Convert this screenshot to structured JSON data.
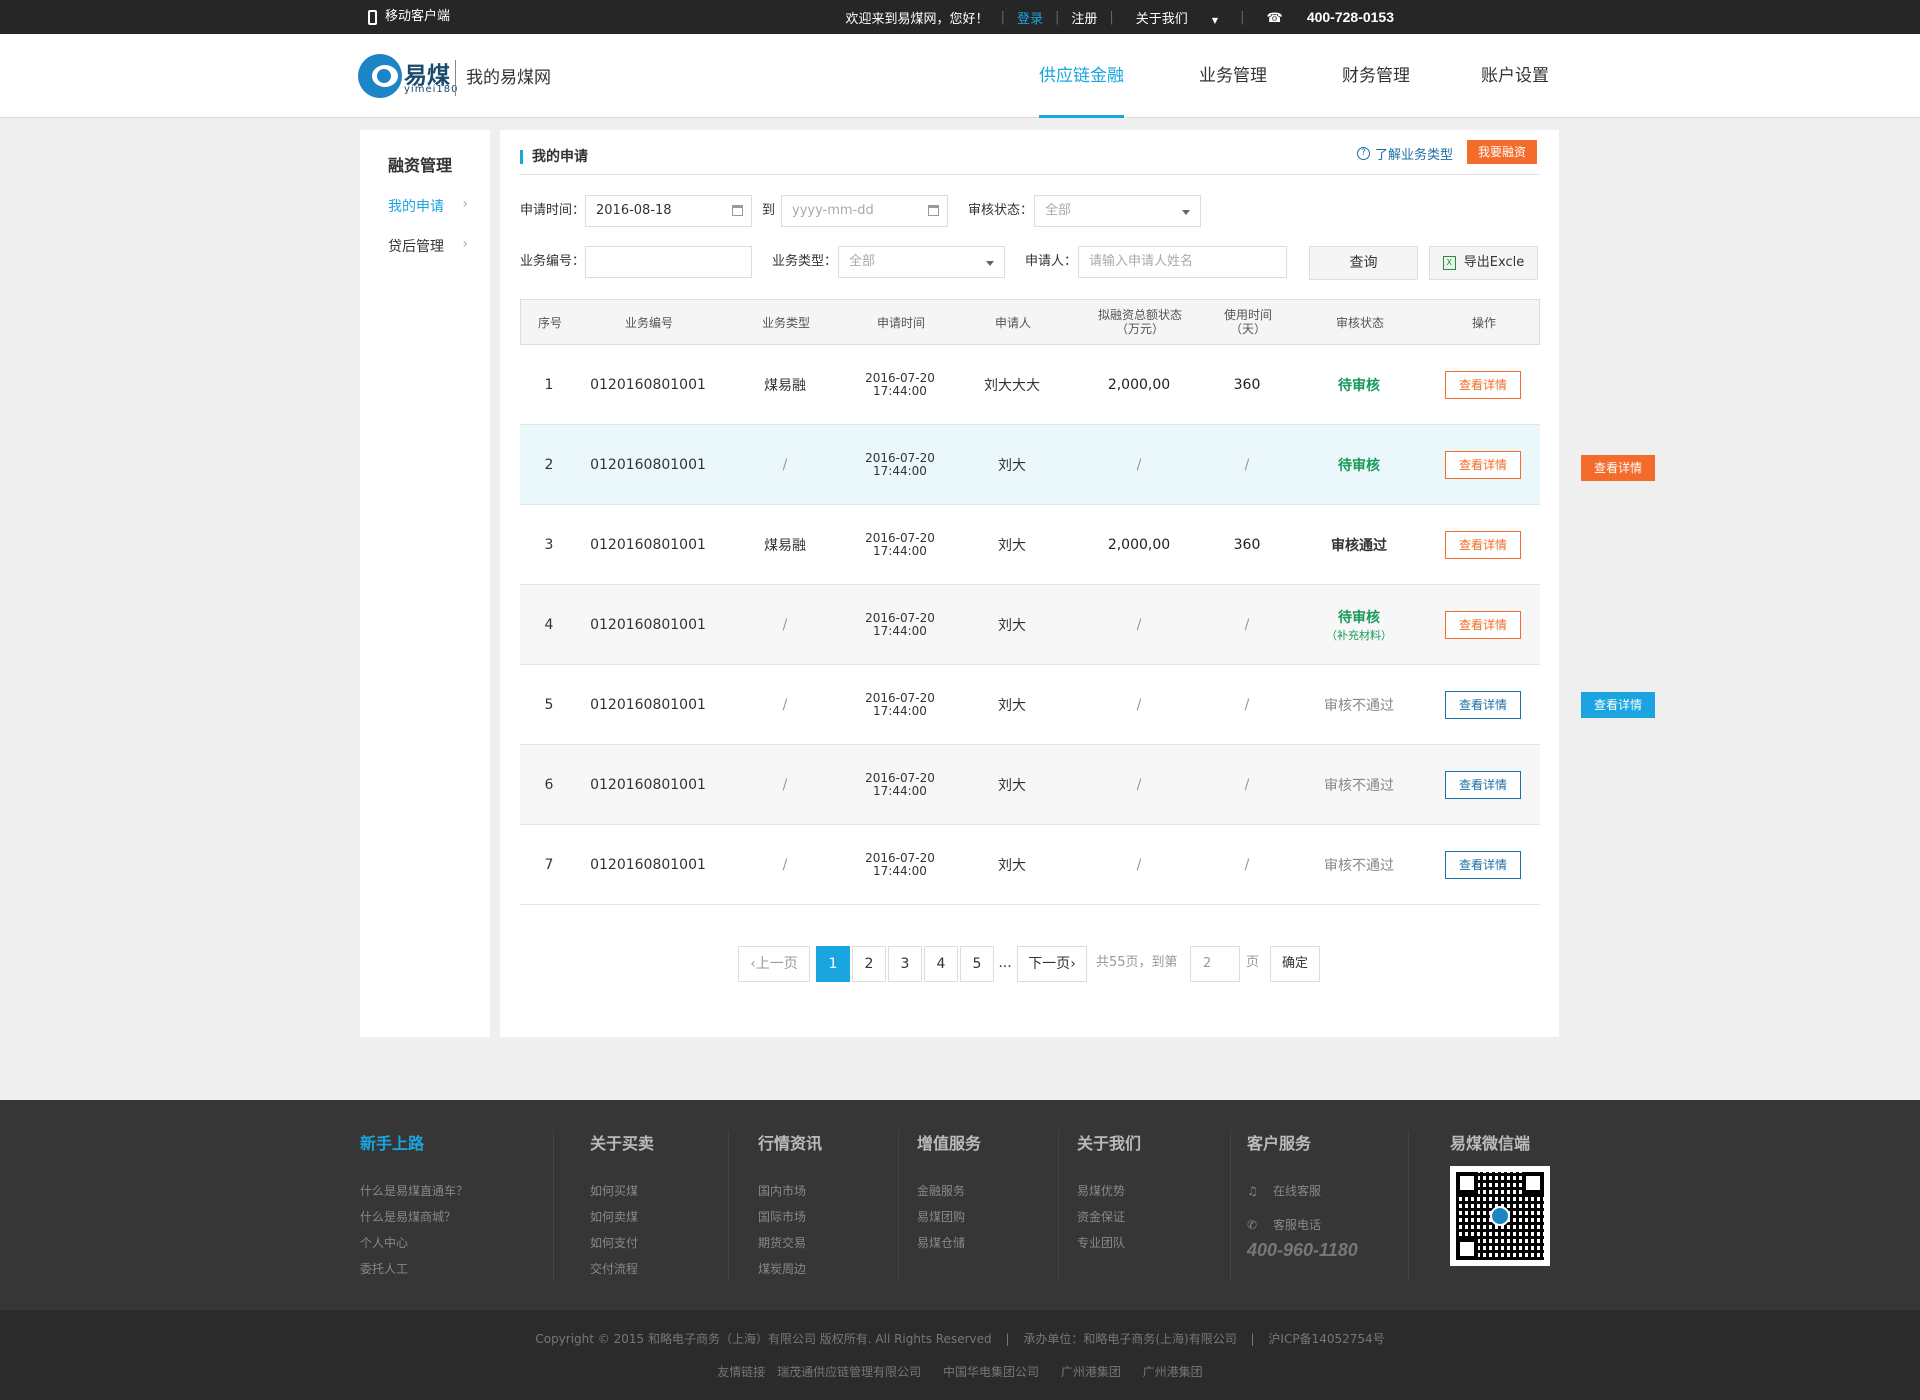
{
  "topbar": {
    "mobile": "移动客户端",
    "welcome": "欢迎来到易煤网，您好！",
    "login": "登录",
    "register": "注册",
    "about": "关于我们",
    "phone": "400-728-0153"
  },
  "header": {
    "logo_text": "易煤",
    "logo_sub": "yimei180",
    "site_name": "我的易煤网",
    "nav": [
      "供应链金融",
      "业务管理",
      "财务管理",
      "账户设置"
    ]
  },
  "sidebar": {
    "title": "融资管理",
    "items": [
      "我的申请",
      "贷后管理"
    ]
  },
  "main": {
    "title": "我的申请",
    "help_link": "了解业务类型",
    "apply_button": "我要融资"
  },
  "filters": {
    "apply_time_label": "申请时间：",
    "date_from": "2016-08-18",
    "to_label": "到",
    "date_to_placeholder": "yyyy-mm-dd",
    "review_status_label": "审核状态：",
    "review_status_value": "全部",
    "biz_no_label": "业务编号：",
    "biz_type_label": "业务类型：",
    "biz_type_value": "全部",
    "applicant_label": "申请人：",
    "applicant_placeholder": "请输入申请人姓名",
    "query_button": "查询",
    "export_button": "导出Excle"
  },
  "table": {
    "headers": [
      "序号",
      "业务编号",
      "业务类型",
      "申请时间",
      "申请人",
      "拟融资总额状态",
      "（万元）",
      "使用时间",
      "（天）",
      "审核状态",
      "操作"
    ],
    "rows": [
      {
        "no": "1",
        "biz_no": "0120160801001",
        "type": "煤易融",
        "date": "2016-07-20",
        "time": "17:44:00",
        "applicant": "刘大大大",
        "amount": "2,000,00",
        "days": "360",
        "status": "待审核",
        "status_note": "",
        "action": "查看详情"
      },
      {
        "no": "2",
        "biz_no": "0120160801001",
        "type": "/",
        "date": "2016-07-20",
        "time": "17:44:00",
        "applicant": "刘大",
        "amount": "/",
        "days": "/",
        "status": "待审核",
        "status_note": "",
        "action": "查看详情"
      },
      {
        "no": "3",
        "biz_no": "0120160801001",
        "type": "煤易融",
        "date": "2016-07-20",
        "time": "17:44:00",
        "applicant": "刘大",
        "amount": "2,000,00",
        "days": "360",
        "status": "审核通过",
        "status_note": "",
        "action": "查看详情"
      },
      {
        "no": "4",
        "biz_no": "0120160801001",
        "type": "/",
        "date": "2016-07-20",
        "time": "17:44:00",
        "applicant": "刘大",
        "amount": "/",
        "days": "/",
        "status": "待审核",
        "status_note": "（补充材料）",
        "action": "查看详情"
      },
      {
        "no": "5",
        "biz_no": "0120160801001",
        "type": "/",
        "date": "2016-07-20",
        "time": "17:44:00",
        "applicant": "刘大",
        "amount": "/",
        "days": "/",
        "status": "审核不通过",
        "status_note": "",
        "action": "查看详情"
      },
      {
        "no": "6",
        "biz_no": "0120160801001",
        "type": "/",
        "date": "2016-07-20",
        "time": "17:44:00",
        "applicant": "刘大",
        "amount": "/",
        "days": "/",
        "status": "审核不通过",
        "status_note": "",
        "action": "查看详情"
      },
      {
        "no": "7",
        "biz_no": "0120160801001",
        "type": "/",
        "date": "2016-07-20",
        "time": "17:44:00",
        "applicant": "刘大",
        "amount": "/",
        "days": "/",
        "status": "审核不通过",
        "status_note": "",
        "action": "查看详情"
      }
    ]
  },
  "hover_buttons": {
    "orange": "查看详情",
    "blue": "查看详情"
  },
  "pagination": {
    "prev": "上一页",
    "pages": [
      "1",
      "2",
      "3",
      "4",
      "5"
    ],
    "ellipsis": "...",
    "next": "下一页",
    "total": "共55页，到第",
    "goto_value": "2",
    "page_unit": "页",
    "confirm": "确定"
  },
  "footer": {
    "cols": [
      {
        "title": "新手上路",
        "links": [
          "什么是易煤直通车？",
          "什么是易煤商城？",
          "个人中心",
          "委托人工"
        ]
      },
      {
        "title": "关于买卖",
        "links": [
          "如何买煤",
          "如何卖煤",
          "如何支付",
          "交付流程"
        ]
      },
      {
        "title": "行情资讯",
        "links": [
          "国内市场",
          "国际市场",
          "期货交易",
          "煤炭周边"
        ]
      },
      {
        "title": "增值服务",
        "links": [
          "金融服务",
          "易煤团购",
          "易煤仓储"
        ]
      },
      {
        "title": "关于我们",
        "links": [
          "易煤优势",
          "资金保证",
          "专业团队"
        ]
      }
    ],
    "service": {
      "title": "客户服务",
      "online": "在线客服",
      "phone_label": "客服电话",
      "phone": "400-960-1180"
    },
    "wechat": {
      "title": "易煤微信端"
    },
    "copyright": "Copyright © 2015 和略电子商务（上海）有限公司 版权所有. All Rights Reserved",
    "sep": "|",
    "operator": "承办单位：和略电子商务(上海)有限公司",
    "icp": "沪ICP备14052754号",
    "friend_label": "友情链接",
    "friends": [
      "瑞茂通供应链管理有限公司",
      "中国华电集团公司",
      "广州港集团",
      "广州港集团"
    ]
  },
  "colors": {
    "accent": "#1aa5e0",
    "orange": "#f36c2b",
    "green": "#1a9a5a"
  }
}
